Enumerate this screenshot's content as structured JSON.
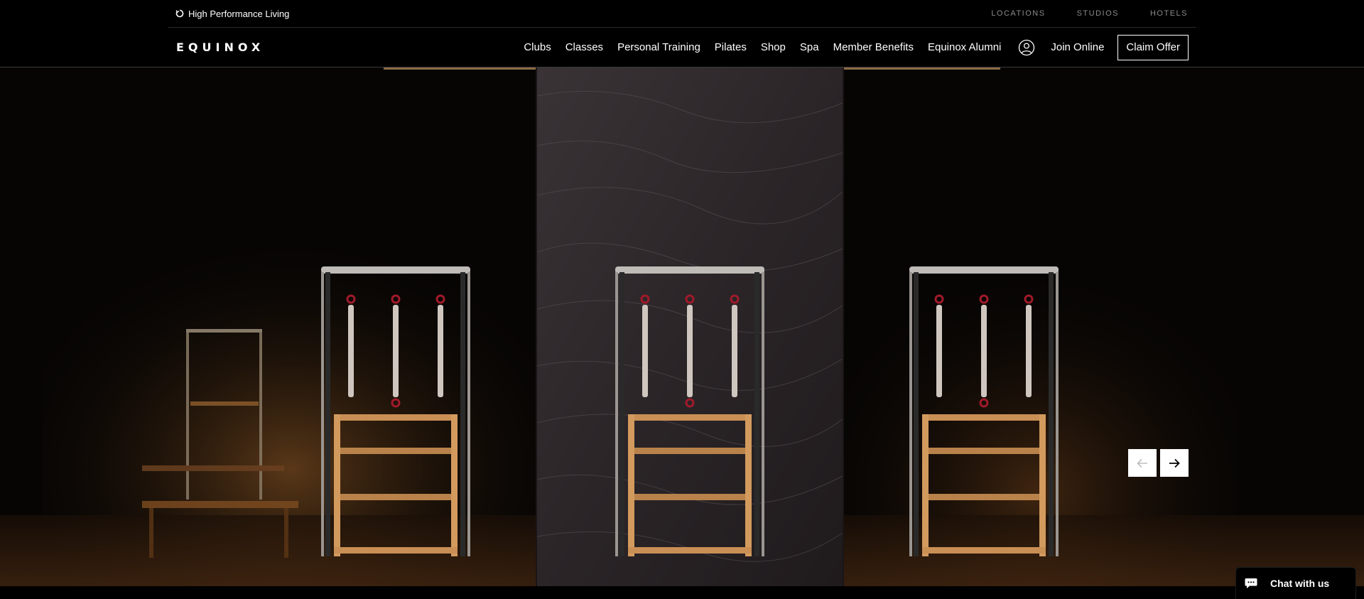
{
  "utility": {
    "tagline": "High Performance Living",
    "links": [
      "LOCATIONS",
      "STUDIOS",
      "HOTELS"
    ]
  },
  "nav": {
    "logo": "EQUINOX",
    "links": [
      "Clubs",
      "Classes",
      "Personal Training",
      "Pilates",
      "Shop",
      "Spa",
      "Member Benefits",
      "Equinox Alumni"
    ],
    "join_label": "Join Online",
    "claim_label": "Claim Offer"
  },
  "chat": {
    "label": "Chat with us"
  },
  "icons": {
    "tagline": "refresh-icon",
    "account": "user-circle-icon",
    "prev": "arrow-left-icon",
    "next": "arrow-right-icon",
    "chat": "chat-bubble-icon"
  },
  "colors": {
    "background": "#000000",
    "text": "#ffffff",
    "muted": "#8a8a8a",
    "wood": "#c98f55",
    "spring": "#a01a2a"
  }
}
